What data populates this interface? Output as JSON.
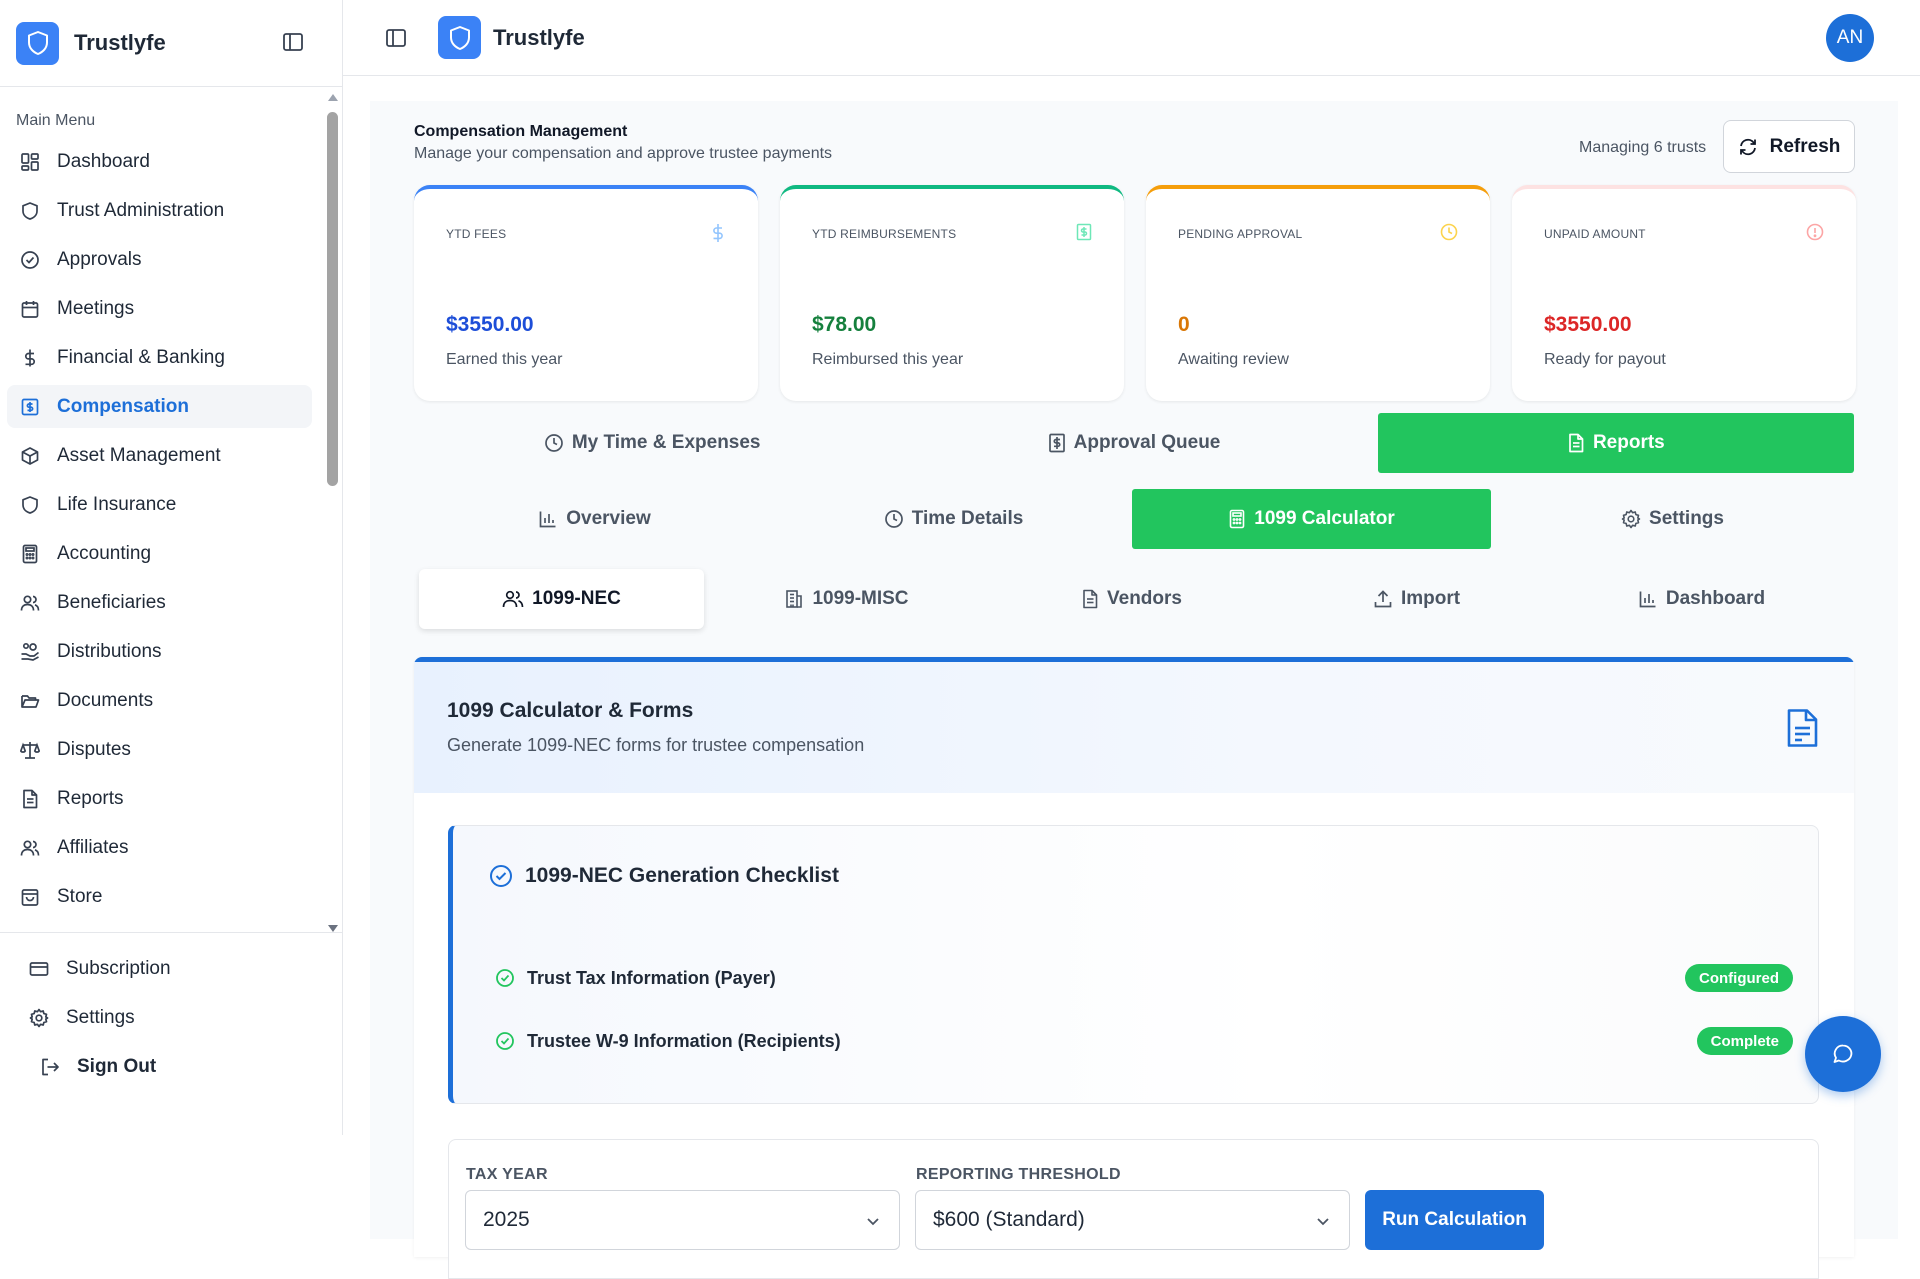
{
  "app": {
    "brand": "Trustlyfe",
    "avatar_initials": "AN"
  },
  "sidebar": {
    "section_title": "Main Menu",
    "items": [
      {
        "label": "Dashboard",
        "icon": "grid-icon"
      },
      {
        "label": "Trust Administration",
        "icon": "shield-icon"
      },
      {
        "label": "Approvals",
        "icon": "check-circle-icon"
      },
      {
        "label": "Meetings",
        "icon": "calendar-icon"
      },
      {
        "label": "Financial & Banking",
        "icon": "dollar-icon"
      },
      {
        "label": "Compensation",
        "icon": "dollar-square-icon",
        "active": true
      },
      {
        "label": "Asset Management",
        "icon": "box-icon"
      },
      {
        "label": "Life Insurance",
        "icon": "shield-icon"
      },
      {
        "label": "Accounting",
        "icon": "calculator-icon"
      },
      {
        "label": "Beneficiaries",
        "icon": "users-icon"
      },
      {
        "label": "Distributions",
        "icon": "hand-coins-icon"
      },
      {
        "label": "Documents",
        "icon": "folder-icon"
      },
      {
        "label": "Disputes",
        "icon": "scale-icon"
      },
      {
        "label": "Reports",
        "icon": "file-text-icon"
      },
      {
        "label": "Affiliates",
        "icon": "users-icon"
      },
      {
        "label": "Store",
        "icon": "shopping-bag-icon"
      }
    ],
    "footer": {
      "subscription": "Subscription",
      "settings": "Settings",
      "sign_out": "Sign Out"
    }
  },
  "header": {
    "title": "Compensation Management",
    "subtitle": "Manage your compensation and approve trustee payments",
    "managing": "Managing 6 trusts",
    "refresh_label": "Refresh"
  },
  "stats": [
    {
      "label": "YTD FEES",
      "value": "$3550.00",
      "note": "Earned this year",
      "accent": "#3b82f6",
      "value_color": "#1d4ed8",
      "icon": "dollar-icon"
    },
    {
      "label": "YTD REIMBURSEMENTS",
      "value": "$78.00",
      "note": "Reimbursed this year",
      "accent": "#10b981",
      "value_color": "#15803d",
      "icon": "receipt-icon"
    },
    {
      "label": "PENDING APPROVAL",
      "value": "0",
      "note": "Awaiting review",
      "accent": "#f59e0b",
      "value_color": "#d97706",
      "icon": "clock-icon"
    },
    {
      "label": "UNPAID AMOUNT",
      "value": "$3550.00",
      "note": "Ready for payout",
      "accent": "#fde2e2",
      "value_color": "#dc2626",
      "icon": "alert-circle-icon"
    }
  ],
  "main_tabs": [
    {
      "label": "My Time & Expenses",
      "icon": "clock-icon"
    },
    {
      "label": "Approval Queue",
      "icon": "receipt-icon"
    },
    {
      "label": "Reports",
      "icon": "file-text-icon",
      "active": true
    }
  ],
  "report_tabs": [
    {
      "label": "Overview",
      "icon": "bar-chart-icon"
    },
    {
      "label": "Time Details",
      "icon": "clock-icon"
    },
    {
      "label": "1099 Calculator",
      "icon": "calculator-icon",
      "active": true
    },
    {
      "label": "Settings",
      "icon": "gear-icon"
    }
  ],
  "form_tabs": [
    {
      "label": "1099-NEC",
      "icon": "users-icon",
      "active": true
    },
    {
      "label": "1099-MISC",
      "icon": "building-icon"
    },
    {
      "label": "Vendors",
      "icon": "file-text-icon"
    },
    {
      "label": "Import",
      "icon": "upload-icon"
    },
    {
      "label": "Dashboard",
      "icon": "bar-chart-icon"
    }
  ],
  "panel": {
    "title": "1099 Calculator & Forms",
    "subtitle": "Generate 1099-NEC forms for trustee compensation",
    "checklist": {
      "title": "1099-NEC Generation Checklist",
      "items": [
        {
          "label": "Trust Tax Information (Payer)",
          "status": "Configured"
        },
        {
          "label": "Trustee W-9 Information (Recipients)",
          "status": "Complete"
        }
      ]
    },
    "tax_year": {
      "label": "TAX YEAR",
      "value": "2025"
    },
    "threshold": {
      "label": "REPORTING THRESHOLD",
      "value": "$600 (Standard)"
    },
    "run_label": "Run Calculation"
  },
  "colors": {
    "primary": "#1d6fd8",
    "success": "#22c55e"
  }
}
